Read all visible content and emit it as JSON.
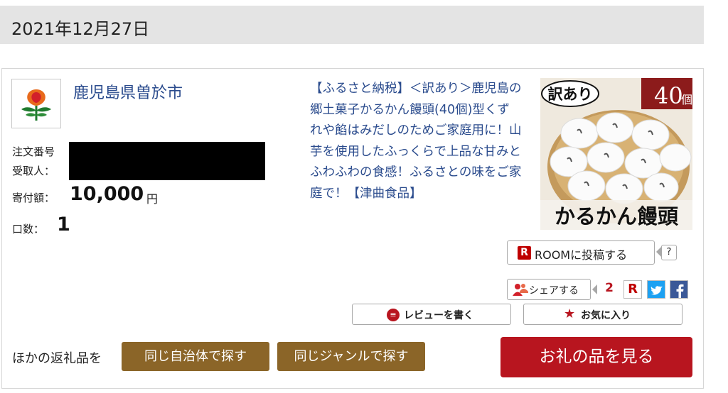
{
  "header": {
    "date": "2021年12月27日"
  },
  "municipality": {
    "name": "鹿児島県曽於市",
    "logo_icon": "city-emblem-icon"
  },
  "order": {
    "order_number_label": "注文番号",
    "recipient_label": "受取人：",
    "donation_label": "寄付額：",
    "donation_amount": "10,000",
    "donation_unit": "円",
    "quantity_label": "口数：",
    "quantity_value": "1"
  },
  "product": {
    "description": "【ふるさと納税】＜訳あり＞鹿児島の郷土菓子かるかん饅頭(40個)型くずれや餡はみだしのためご家庭用に！山芋を使用したふっくらで上品な甘みとふわふわの食感！ふるさとの味をご家庭で！【津曲食品】",
    "image_badge_wakeari": "訳あり",
    "image_badge_count": "40",
    "image_badge_unit": "個",
    "image_caption": "かるかん饅頭"
  },
  "actions": {
    "room_label": "ROOMに投稿する",
    "room_help": "?",
    "share_label": "シェアする",
    "share_count": "2",
    "review_label": "レビューを書く",
    "favorite_label": "お気に入り"
  },
  "footer": {
    "other_label": "ほかの返礼品を",
    "same_city_button": "同じ自治体で探す",
    "same_genre_button": "同じジャンルで探す",
    "view_item_button": "お礼の品を見る"
  },
  "colors": {
    "link": "#2a4b8d",
    "brown": "#8b6528",
    "red": "#b8151f",
    "header_bg": "#e4e4e4"
  }
}
